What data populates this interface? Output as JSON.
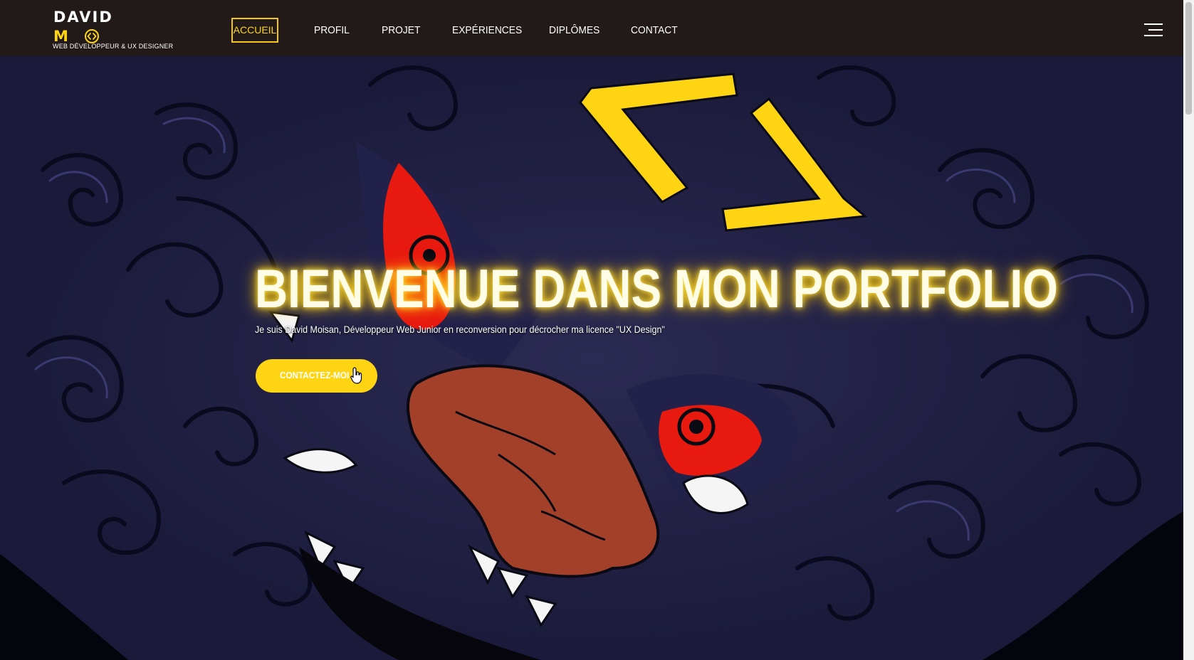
{
  "brand": {
    "name_line1": "DAVID",
    "name_line2": "M",
    "tagline": "WEB DÉVELOPPEUR & UX DESIGNER",
    "icon": "code-brackets-icon"
  },
  "nav": {
    "items": [
      {
        "label": "ACCUEIL",
        "active": true
      },
      {
        "label": "PROFIL",
        "active": false
      },
      {
        "label": "PROJET",
        "active": false
      },
      {
        "label": "EXPÉRIENCES",
        "active": false
      },
      {
        "label": "DIPLÔMES",
        "active": false
      },
      {
        "label": "CONTACT",
        "active": false
      }
    ],
    "menu_icon": "hamburger-menu-icon"
  },
  "hero": {
    "title": "BIENVENUE DANS MON PORTFOLIO",
    "subtitle": "Je suis David Moisan, Développeur Web Junior en reconversion pour décrocher ma licence \"UX Design\"",
    "cta_label": "CONTACTEZ-MOI !",
    "background": "foo-dog-illustration"
  },
  "colors": {
    "accent": "#ffd513",
    "navbar_bg": "#211a19",
    "hero_bg": "#232244",
    "eye_red": "#e8190f",
    "nose": "#a2402a"
  }
}
